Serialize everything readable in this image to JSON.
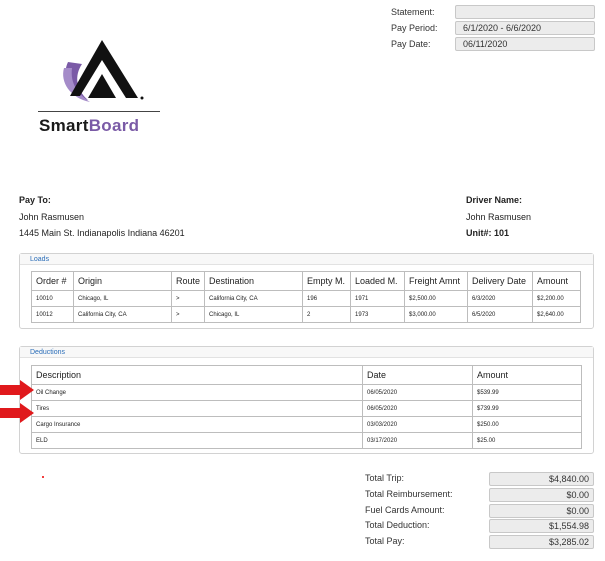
{
  "header": {
    "statement_label": "Statement:",
    "statement_value": "",
    "pay_period_label": "Pay Period:",
    "pay_period_value": "6/1/2020 - 6/6/2020",
    "pay_date_label": "Pay Date:",
    "pay_date_value": "06/11/2020"
  },
  "logo": {
    "text_smart": "Smart",
    "text_board": "Board",
    "mark_icon": "smartboard-logo-icon"
  },
  "pay_to": {
    "label": "Pay To:",
    "name": "John Rasmusen",
    "address": "1445 Main St. Indianapolis Indiana 46201"
  },
  "driver": {
    "label": "Driver Name:",
    "name": "John Rasmusen",
    "unit": "Unit#: 101"
  },
  "loads": {
    "title": "Loads",
    "columns": [
      "Order #",
      "Origin",
      "Route",
      "Destination",
      "Empty M.",
      "Loaded M.",
      "Freight Amnt",
      "Delivery Date",
      "Amount"
    ],
    "rows": [
      [
        "10010",
        "Chicago, IL",
        ">",
        "California City, CA",
        "196",
        "1971",
        "$2,500.00",
        "6/3/2020",
        "$2,200.00"
      ],
      [
        "10012",
        "California City, CA",
        ">",
        "Chicago, IL",
        "2",
        "1973",
        "$3,000.00",
        "6/5/2020",
        "$2,640.00"
      ]
    ]
  },
  "deductions": {
    "title": "Deductions",
    "columns": [
      "Description",
      "Date",
      "Amount"
    ],
    "rows": [
      [
        "Oil Change",
        "06/05/2020",
        "$539.99"
      ],
      [
        "Tires",
        "06/05/2020",
        "$739.99"
      ],
      [
        "Cargo Insurance",
        "03/03/2020",
        "$250.00"
      ],
      [
        "ELD",
        "03/17/2020",
        "$25.00"
      ]
    ]
  },
  "totals": {
    "total_trip_label": "Total Trip:",
    "total_trip_value": "$4,840.00",
    "total_reimbursement_label": "Total Reimbursement:",
    "total_reimbursement_value": "$0.00",
    "fuel_cards_label": "Fuel Cards Amount:",
    "fuel_cards_value": "$0.00",
    "total_deduction_label": "Total Deduction:",
    "total_deduction_value": "$1,554.98",
    "total_pay_label": "Total Pay:",
    "total_pay_value": "$3,285.02"
  },
  "colors": {
    "brand_purple": "#7a5aa6",
    "link_blue": "#2a6db8",
    "arrow_red": "#e0191c"
  }
}
